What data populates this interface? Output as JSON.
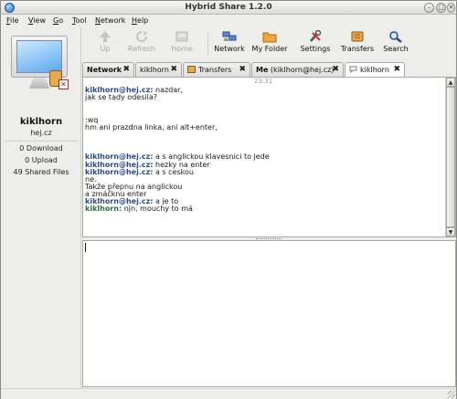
{
  "window": {
    "title": "Hybrid Share 1.2.0"
  },
  "menu": [
    {
      "label": "File",
      "mnemonic": "F",
      "rest": "ile"
    },
    {
      "label": "View",
      "mnemonic": "V",
      "rest": "iew"
    },
    {
      "label": "Go",
      "mnemonic": "G",
      "rest": "o"
    },
    {
      "label": "Tool",
      "mnemonic": "T",
      "rest": "ool"
    },
    {
      "label": "Network",
      "mnemonic": "N",
      "rest": "etwork"
    },
    {
      "label": "Help",
      "mnemonic": "H",
      "rest": "elp"
    }
  ],
  "profile": {
    "name": "kiklhorn",
    "host": "hej.cz",
    "downloads": "0 Download",
    "uploads": "0 Upload",
    "shared": "49 Shared Files"
  },
  "toolbar": {
    "up": "Up",
    "refresh": "Refresh",
    "home": "Home",
    "network": "Network",
    "my_folder": "My Folder",
    "settings": "Settings",
    "transfers": "Transfers",
    "search": "Search"
  },
  "tabs": [
    {
      "label": "Network",
      "active": false,
      "bold": true
    },
    {
      "label": "kiklhorn",
      "active": false,
      "bold": false
    },
    {
      "label": "Transfers",
      "active": false,
      "bold": false
    },
    {
      "label": "Me",
      "label_extra": " (kiklhorn@hej.cz)",
      "active": false,
      "bold": true
    },
    {
      "label": "kiklhorn",
      "active": true,
      "bold": false
    }
  ],
  "chat": {
    "timestamp": "23:31",
    "messages": [
      {
        "from": "kiklhorn@hej.cz:",
        "text": " nazdar,",
        "kind": "other"
      },
      {
        "from": "",
        "text": "jak se tady odesila?",
        "kind": "plain"
      },
      {
        "from": "",
        "text": "",
        "kind": "blank"
      },
      {
        "from": "",
        "text": "",
        "kind": "blank"
      },
      {
        "from": "",
        "text": ":wq",
        "kind": "plain"
      },
      {
        "from": "",
        "text": "hm ani prazdna linka, ani alt+enter,",
        "kind": "plain"
      },
      {
        "from": "",
        "text": "",
        "kind": "blank"
      },
      {
        "from": "",
        "text": "",
        "kind": "blank"
      },
      {
        "from": "",
        "text": "",
        "kind": "blank"
      },
      {
        "from": "kiklhorn@hej.cz:",
        "text": " a s anglickou klavesnici to jede",
        "kind": "other"
      },
      {
        "from": "kiklhorn@hej.cz:",
        "text": " hezky na enter",
        "kind": "other"
      },
      {
        "from": "kiklhorn@hej.cz:",
        "text": " a s ceskou",
        "kind": "other"
      },
      {
        "from": "",
        "text": "ne.",
        "kind": "plain"
      },
      {
        "from": "",
        "text": "Takže přepnu na anglickou",
        "kind": "plain"
      },
      {
        "from": "",
        "text": "a zmáčknu enter",
        "kind": "plain"
      },
      {
        "from": "kiklhorn@hej.cz:",
        "text": " a je to",
        "kind": "other"
      },
      {
        "from": "kiklhorn:",
        "text": " njn, mouchy to má",
        "kind": "self"
      }
    ]
  },
  "input": {
    "value": ""
  }
}
